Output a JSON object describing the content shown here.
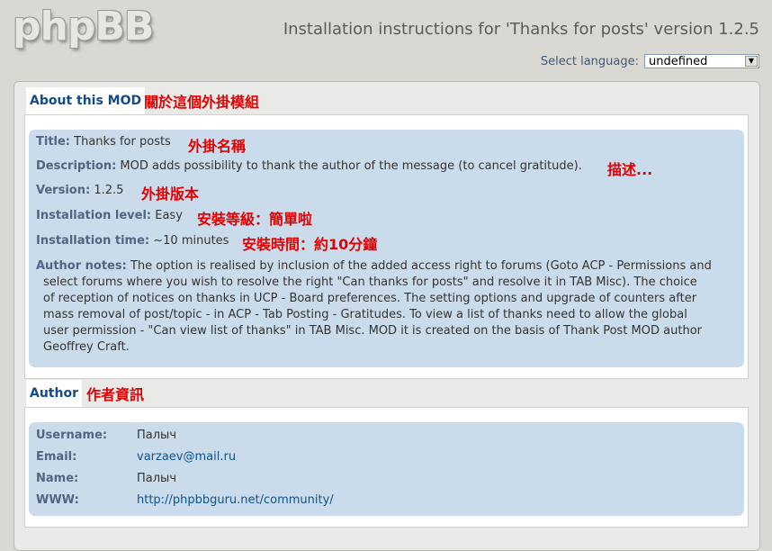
{
  "header": {
    "logo": "phpBB",
    "title": "Installation instructions for 'Thanks for posts' version 1.2.5",
    "language_label": "Select language:",
    "language_value": "undefined"
  },
  "about": {
    "tab": "About this MOD",
    "tab_note": "關於這個外掛模組",
    "title_label": "Title:",
    "title_value": "Thanks for posts",
    "title_note": "外掛名稱",
    "desc_label": "Description:",
    "desc_value": "MOD adds possibility to thank the author of the message (to cancel gratitude).",
    "desc_note": "描述...",
    "version_label": "Version:",
    "version_value": "1.2.5",
    "version_note": "外掛版本",
    "level_label": "Installation level:",
    "level_value": "Easy",
    "level_note": "安裝等級：簡單啦",
    "time_label": "Installation time:",
    "time_value": "~10 minutes",
    "time_note": "安裝時間：約10分鐘",
    "notes_label": "Author notes:",
    "notes_line1": "The option is realised by inclusion of the added access right to forums (Goto ACP - Permissions and",
    "notes_line2": "select forums where you wish to resolve the right \"Can thanks for posts\" and resolve it in TAB Misc). The choice",
    "notes_line3": "of reception of notices on thanks in UCP - Board preferences. The setting options and upgrade of counters after",
    "notes_line4": "mass removal of post/topic - in ACP - Tab Posting - Gratitudes. To view a list of thanks need to allow the global",
    "notes_line5": "user permission - \"Can view list of thanks\" in TAB Misc. MOD it is created on the basis of Thank Post MOD author",
    "notes_line6": "Geoffrey Craft."
  },
  "author": {
    "tab": "Author",
    "tab_note": "作者資訊",
    "username_label": "Username:",
    "username_value": "Палыч",
    "email_label": "Email:",
    "email_value": "varzaev@mail.ru",
    "name_label": "Name:",
    "name_value": "Палыч",
    "www_label": "WWW:",
    "www_value": "http://phpbbguru.net/community/"
  }
}
